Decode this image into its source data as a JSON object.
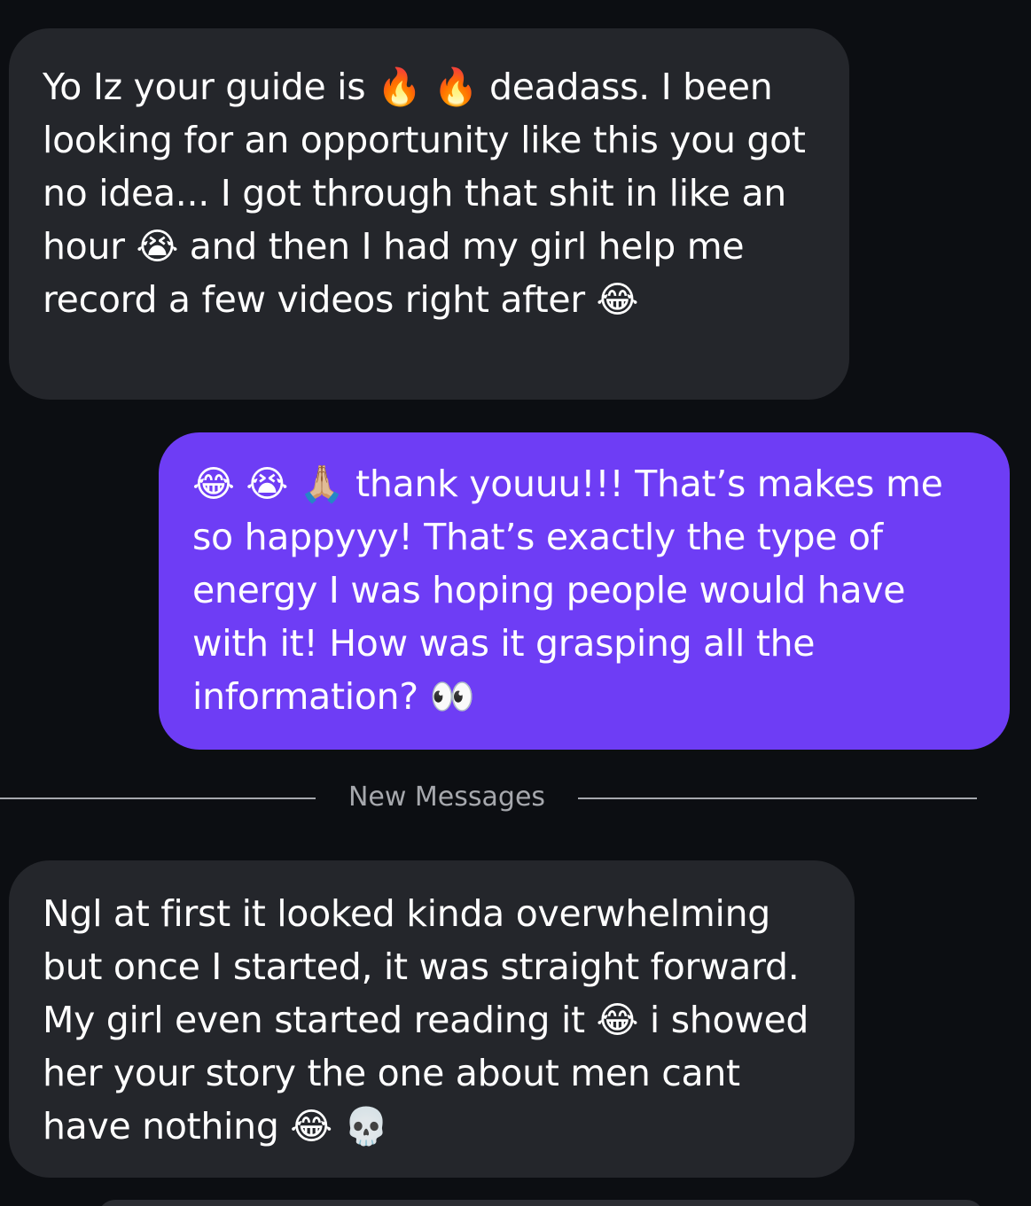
{
  "messages": [
    {
      "direction": "incoming",
      "text": "Yo Iz your guide is 🔥 🔥 deadass. I been looking for an opportunity like this you got no idea... I got through that shit in like an hour 😭 and then I had my girl help me record a few videos right after 😂"
    },
    {
      "direction": "outgoing",
      "text": "😂 😭 🙏🏼 thank youuu!!! That’s makes me so happyyy! That’s exactly the type of energy I was hoping people would have with it! How was it grasping all the information? 👀"
    },
    {
      "direction": "incoming",
      "text": "Ngl at first it looked kinda overwhelming but once I started, it was straight forward. My girl even started reading it 😂 i showed her your story the one about men cant have nothing 😂 💀"
    }
  ],
  "divider": {
    "label": "New Messages"
  },
  "colors": {
    "background": "#0c0e12",
    "incoming_bubble": "#24262b",
    "outgoing_bubble": "#6e3df5",
    "text": "#ffffff",
    "divider": "#a6a8ad"
  }
}
